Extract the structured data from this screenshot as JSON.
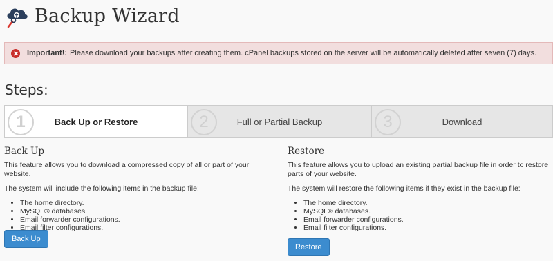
{
  "header": {
    "title": "Backup Wizard",
    "logo_icon": "cloud-backup-icon"
  },
  "alert": {
    "prefix": "Important!:",
    "message": "Please download your backups after creating them. cPanel backups stored on the server will be automatically deleted after seven (7) days.",
    "icon": "error-circle-icon",
    "color": "#f2dede"
  },
  "steps": {
    "heading": "Steps:",
    "items": [
      {
        "number": "1",
        "label": "Back Up or Restore",
        "active": true
      },
      {
        "number": "2",
        "label": "Full or Partial Backup",
        "active": false
      },
      {
        "number": "3",
        "label": "Download",
        "active": false
      }
    ]
  },
  "backup": {
    "title": "Back Up",
    "description": "This feature allows you to download a compressed copy of all or part of your website.",
    "intro": "The system will include the following items in the backup file:",
    "items": [
      "The home directory.",
      "MySQL® databases.",
      "Email forwarder configurations.",
      "Email filter configurations."
    ],
    "button_label": "Back Up"
  },
  "restore": {
    "title": "Restore",
    "description": "This feature allows you to upload an existing partial backup file in order to restore parts of your website.",
    "intro": "The system will restore the following items if they exist in the backup file:",
    "items": [
      "The home directory.",
      "MySQL® databases.",
      "Email forwarder configurations.",
      "Email filter configurations."
    ],
    "button_label": "Restore"
  },
  "colors": {
    "accent": "#3c8ccf",
    "alert_icon": "#c9302c"
  }
}
